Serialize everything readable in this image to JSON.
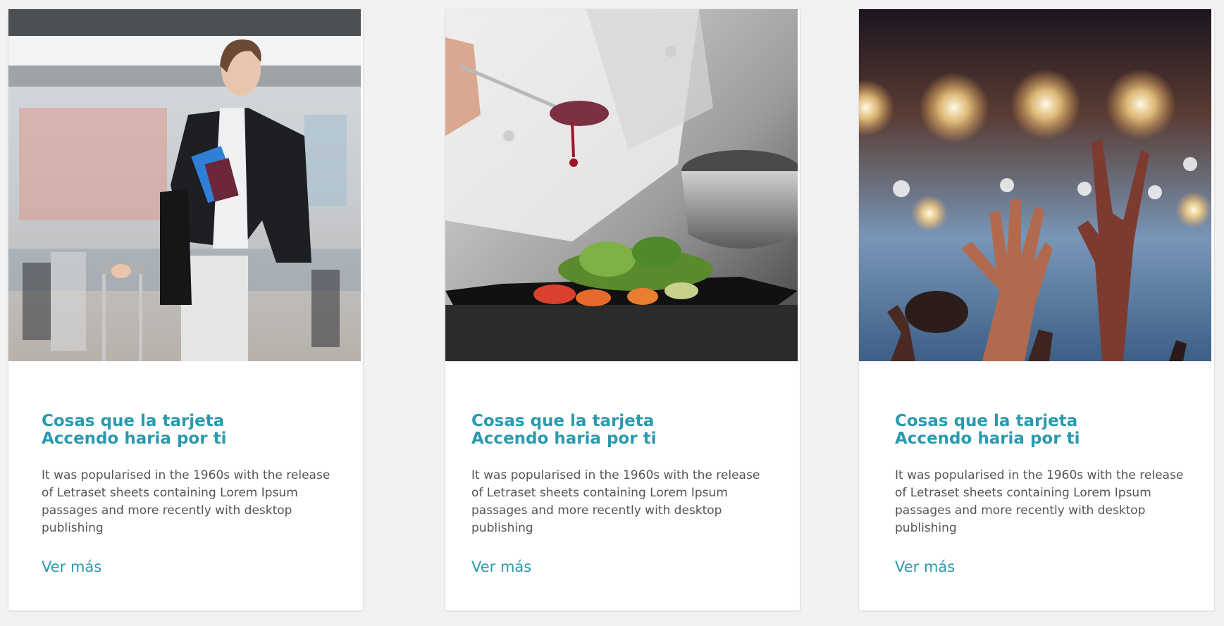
{
  "cards": [
    {
      "image": "woman-airport-passport-photo",
      "title": "Cosas que la tarjeta Accendo haria por ti",
      "description": "It was popularised in the 1960s with the release of Letraset sheets containing Lorem Ipsum passages and more recently with desktop publishing",
      "link": "Ver más"
    },
    {
      "image": "chef-plating-salad-photo",
      "title": "Cosas que la tarjeta Accendo haria por ti",
      "description": "It was popularised in the 1960s with the release of Letraset sheets containing Lorem Ipsum passages and more recently with desktop publishing",
      "link": "Ver más"
    },
    {
      "image": "concert-crowd-hands-photo",
      "title": "Cosas que la tarjeta Accendo haria por ti",
      "description": "It was popularised in the 1960s with the release of Letraset sheets containing Lorem Ipsum passages and more recently with desktop publishing",
      "link": "Ver más"
    }
  ],
  "colors": {
    "accent": "#2a9aae",
    "text": "#555555",
    "background": "#f2f2f2",
    "card": "#ffffff"
  }
}
